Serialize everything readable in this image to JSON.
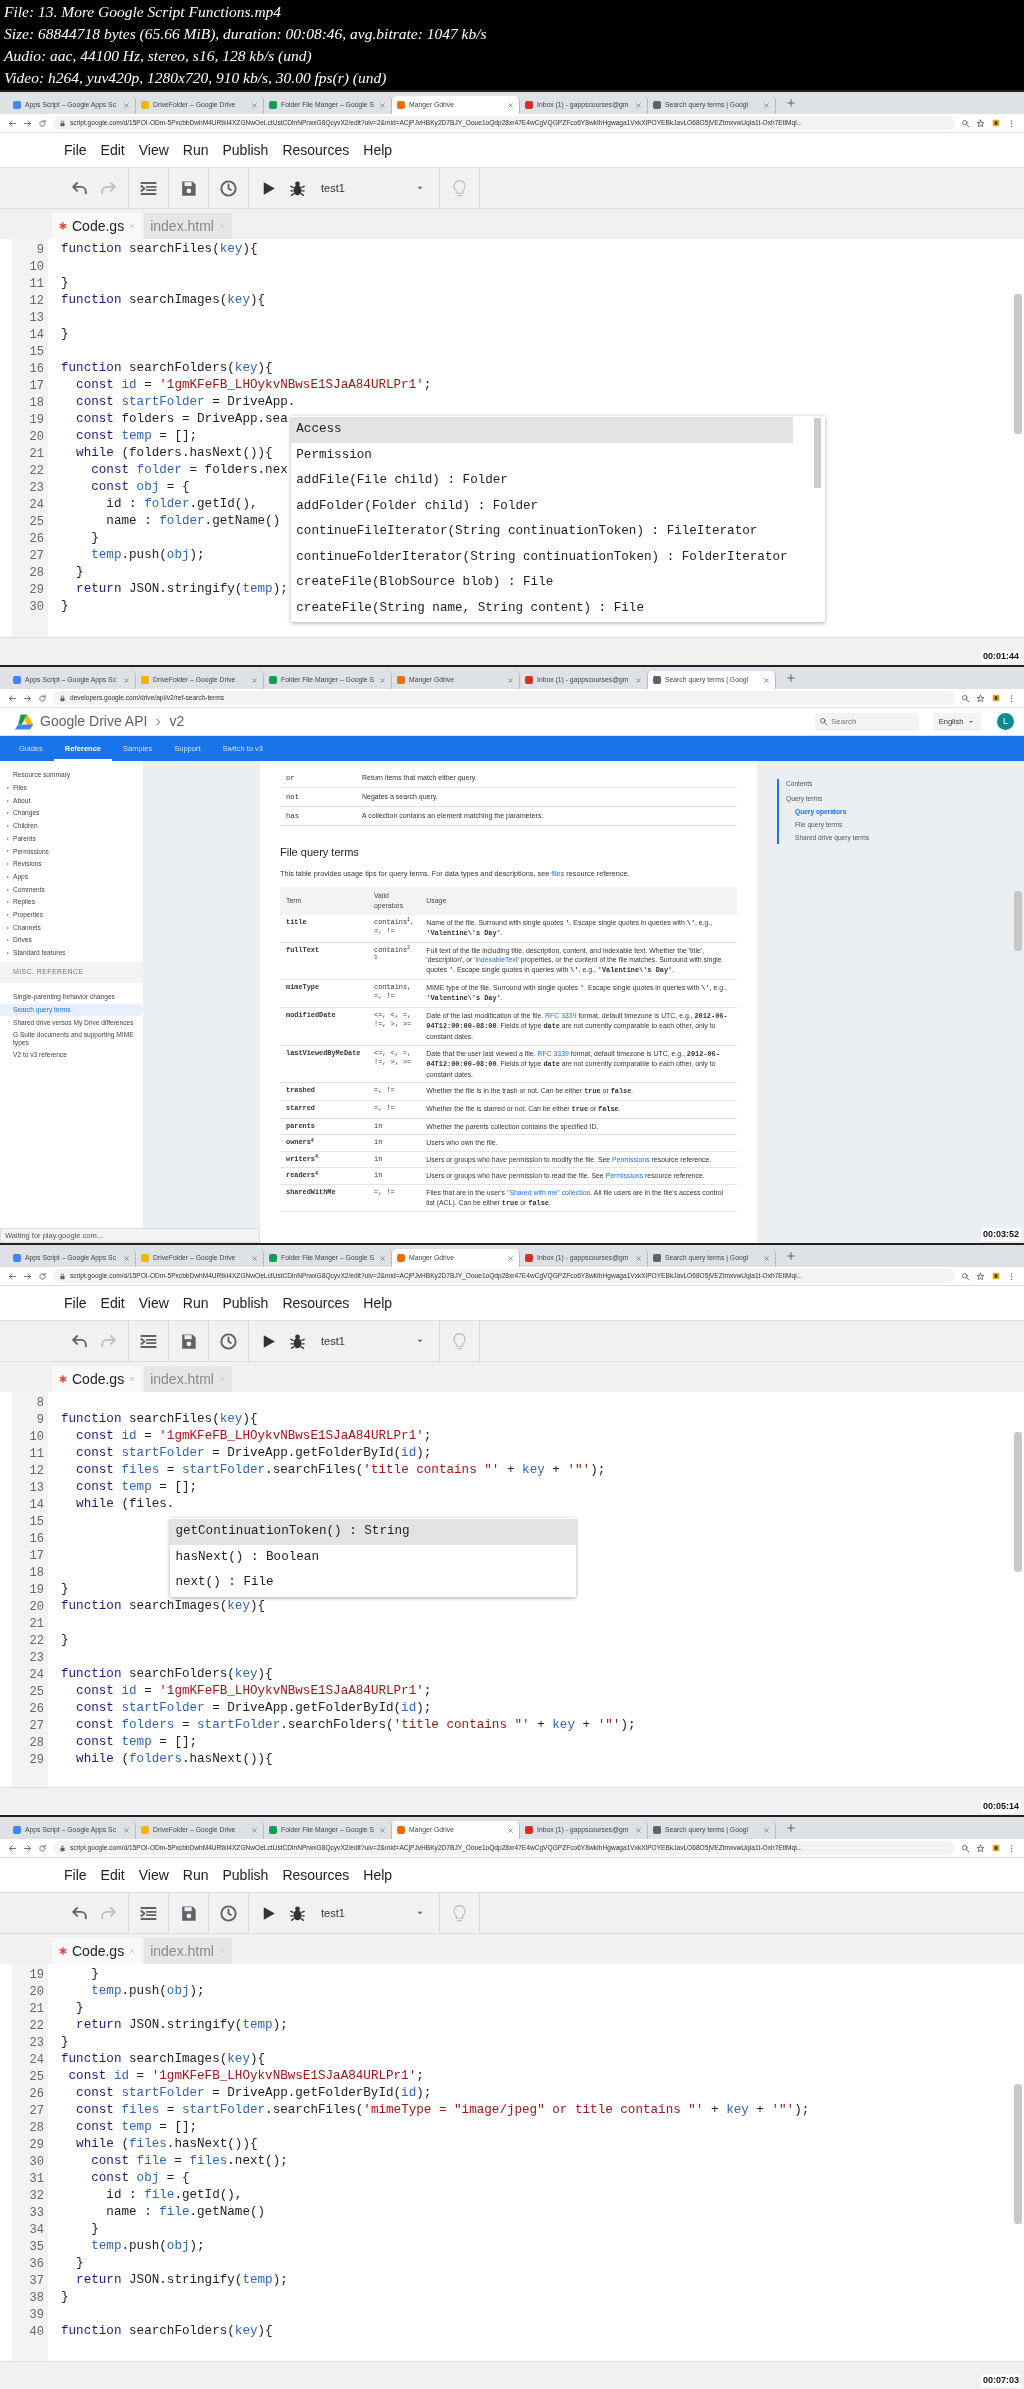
{
  "file_info": [
    "File: 13. More Google Script Functions.mp4",
    "Size: 68844718 bytes (65.66 MiB), duration: 00:08:46, avg.bitrate: 1047 kb/s",
    "Audio: aac, 44100 Hz, stereo, s16, 128 kb/s (und)",
    "Video: h264, yuv420p, 1280x720, 910 kb/s, 30.00 fps(r) (und)"
  ],
  "frames": [
    {
      "kind": "editor",
      "timestamp": "00:01:44",
      "browser": {
        "tabs": [
          {
            "title": "Apps Script – Google Apps Sc",
            "selected": false,
            "color": "#4285f4"
          },
          {
            "title": "DriveFolder – Google Drive",
            "selected": false,
            "color": "#f4b400"
          },
          {
            "title": "Folder File Manger – Google S",
            "selected": false,
            "color": "#0f9d58"
          },
          {
            "title": "Manger Gdrive",
            "selected": true,
            "color": "#e8710a"
          },
          {
            "title": "Inbox (1) - gappscourses@gm",
            "selected": false,
            "color": "#d93025"
          },
          {
            "title": "Search query terms | Googl",
            "selected": false,
            "color": "#5f6368"
          }
        ],
        "url": "script.google.com/d/15POI-ODm-5PxcbbDwhM4URtkI4XZGNwOeLctUstCDlnNPrwxG8QcyvX2/edit?uiv=2&mid=ACjPJvHBKy2D7BJY_Ooue1oQdp28xr47E4wCgVQGPZFco6Y8wkIhHgwaga1VxkXlPOYEBkJavLO68O5jVEZtmxvwUqla1t-Oxh7EtlMql..."
      },
      "menu": [
        "File",
        "Edit",
        "View",
        "Run",
        "Publish",
        "Resources",
        "Help"
      ],
      "toolbar": {
        "redo_disabled": true,
        "function": "test1"
      },
      "file_tabs": [
        {
          "label": "Code.gs",
          "selected": true,
          "modified": true
        },
        {
          "label": "index.html",
          "selected": false,
          "modified": false
        }
      ],
      "code": [
        {
          "n": "9",
          "tokens": [
            {
              "text": "function ",
              "kind": "kw"
            },
            {
              "text": "searchFiles("
            },
            {
              "text": "key",
              "kind": "var"
            },
            {
              "text": "){"
            }
          ]
        },
        {
          "n": "10"
        },
        {
          "n": "11",
          "tokens": [
            {
              "text": "}"
            }
          ]
        },
        {
          "n": "12",
          "tokens": [
            {
              "text": "function ",
              "kind": "kw"
            },
            {
              "text": "searchImages("
            },
            {
              "text": "key",
              "kind": "var"
            },
            {
              "text": "){"
            }
          ]
        },
        {
          "n": "13"
        },
        {
          "n": "14",
          "tokens": [
            {
              "text": "}"
            }
          ]
        },
        {
          "n": "15"
        },
        {
          "n": "16",
          "tokens": [
            {
              "text": "function ",
              "kind": "kw"
            },
            {
              "text": "searchFolders("
            },
            {
              "text": "key",
              "kind": "var"
            },
            {
              "text": "){"
            }
          ]
        },
        {
          "n": "17",
          "tokens": [
            {
              "text": "  const ",
              "kind": "kw"
            },
            {
              "text": "id",
              "kind": "var"
            },
            {
              "text": " = "
            },
            {
              "text": "'1gmKFeFB_LHOykvNBwsE1SJaA84URLPr1'",
              "kind": "str"
            },
            {
              "text": ";"
            }
          ]
        },
        {
          "n": "18",
          "tokens": [
            {
              "text": "  const ",
              "kind": "kw"
            },
            {
              "text": "startFolder",
              "kind": "var"
            },
            {
              "text": " = DriveApp."
            }
          ],
          "autocomplete": [
            {
              "label": "Access",
              "selected": true
            },
            {
              "label": "Permission",
              "selected": false
            },
            {
              "label": "addFile(File child) : Folder",
              "selected": false
            },
            {
              "label": "addFolder(Folder child) : Folder",
              "selected": false
            },
            {
              "label": "continueFileIterator(String continuationToken) : FileIterator",
              "selected": false
            },
            {
              "label": "continueFolderIterator(String continuationToken) : FolderIterator",
              "selected": false
            },
            {
              "label": "createFile(BlobSource blob) : File",
              "selected": false
            },
            {
              "label": "createFile(String name, String content) : File",
              "selected": false
            }
          ]
        },
        {
          "n": "19",
          "tokens": [
            {
              "text": "  const ",
              "kind": "kw"
            },
            {
              "text": "folders = DriveApp.sea"
            }
          ]
        },
        {
          "n": "20",
          "tokens": [
            {
              "text": "  const ",
              "kind": "kw"
            },
            {
              "text": "temp",
              "kind": "var"
            },
            {
              "text": " = [];"
            }
          ]
        },
        {
          "n": "21",
          "tokens": [
            {
              "text": "  while ",
              "kind": "kw"
            },
            {
              "text": "(folders.hasNext()){"
            }
          ]
        },
        {
          "n": "22",
          "tokens": [
            {
              "text": "    const ",
              "kind": "kw"
            },
            {
              "text": "folder",
              "kind": "var"
            },
            {
              "text": " = folders.nex"
            }
          ]
        },
        {
          "n": "23",
          "tokens": [
            {
              "text": "    const ",
              "kind": "kw"
            },
            {
              "text": "obj",
              "kind": "var"
            },
            {
              "text": " = {"
            }
          ]
        },
        {
          "n": "24",
          "tokens": [
            {
              "text": "      id : "
            },
            {
              "text": "folder",
              "kind": "var"
            },
            {
              "text": ".getId(),"
            }
          ]
        },
        {
          "n": "25",
          "tokens": [
            {
              "text": "      name : "
            },
            {
              "text": "folder",
              "kind": "var"
            },
            {
              "text": ".getName()"
            }
          ]
        },
        {
          "n": "26",
          "tokens": [
            {
              "text": "    }"
            }
          ]
        },
        {
          "n": "27",
          "tokens": [
            {
              "text": "    temp",
              "kind": "var"
            },
            {
              "text": ".push("
            },
            {
              "text": "obj",
              "kind": "var"
            },
            {
              "text": ");"
            }
          ]
        },
        {
          "n": "28",
          "tokens": [
            {
              "text": "  }"
            }
          ]
        },
        {
          "n": "29",
          "tokens": [
            {
              "text": "  return ",
              "kind": "kw"
            },
            {
              "text": "JSON.stringify("
            },
            {
              "text": "temp",
              "kind": "var"
            },
            {
              "text": ");"
            }
          ]
        },
        {
          "n": "30",
          "tokens": [
            {
              "text": "}"
            }
          ]
        }
      ]
    },
    {
      "kind": "docs",
      "timestamp": "00:03:52",
      "browser": {
        "tabs": [
          {
            "title": "Apps Script – Google Apps Sc",
            "selected": false,
            "color": "#4285f4"
          },
          {
            "title": "DriveFolder – Google Drive",
            "selected": false,
            "color": "#f4b400"
          },
          {
            "title": "Folder File Manger – Google S",
            "selected": false,
            "color": "#0f9d58"
          },
          {
            "title": "Manger Gdrive",
            "selected": false,
            "color": "#e8710a"
          },
          {
            "title": "Inbox (1) - gappscourses@gm",
            "selected": false,
            "color": "#d93025"
          },
          {
            "title": "Search query terms | Googl",
            "selected": true,
            "color": "#5f6368"
          }
        ],
        "url": "developers.google.com/drive/api/v2/ref-search-terms"
      },
      "page": {
        "breadcrumb": [
          "Google Drive API",
          "v2"
        ],
        "search_placeholder": "Search",
        "language": "English",
        "avatar": "L",
        "nav": [
          {
            "label": "Guides",
            "selected": false
          },
          {
            "label": "Reference",
            "selected": true
          },
          {
            "label": "Samples",
            "selected": false
          },
          {
            "label": "Support",
            "selected": false
          },
          {
            "label": "Switch to v3",
            "selected": false
          }
        ],
        "sidebar": {
          "items": [
            {
              "label": "Resource summary",
              "expandable": false
            },
            {
              "label": "Files",
              "expandable": true
            },
            {
              "label": "About",
              "expandable": true
            },
            {
              "label": "Changes",
              "expandable": true
            },
            {
              "label": "Children",
              "expandable": true
            },
            {
              "label": "Parents",
              "expandable": true
            },
            {
              "label": "Permissions",
              "expandable": true
            },
            {
              "label": "Revisions",
              "expandable": true
            },
            {
              "label": "Apps",
              "expandable": true
            },
            {
              "label": "Comments",
              "expandable": true
            },
            {
              "label": "Replies",
              "expandable": true
            },
            {
              "label": "Properties",
              "expandable": true
            },
            {
              "label": "Channels",
              "expandable": true
            },
            {
              "label": "Drives",
              "expandable": true
            },
            {
              "label": "Standard features",
              "expandable": true
            }
          ],
          "section": "MISC. REFERENCE",
          "section_items": [
            {
              "label": "Single-parenting behavior changes",
              "selected": false
            },
            {
              "label": "Search query terms",
              "selected": true
            },
            {
              "label": "Shared drive versus My Drive differences",
              "selected": false
            },
            {
              "label": "G Suite documents and supporting MIME types",
              "selected": false
            },
            {
              "label": "V2 to v3 reference",
              "selected": false
            }
          ]
        },
        "operators": [
          {
            "op": "or",
            "desc": "Return items that match either query."
          },
          {
            "op": "not",
            "desc": "Negates a search query."
          },
          {
            "op": "has",
            "desc": "A collection contains an element matching the parameters."
          }
        ],
        "heading": "File query terms",
        "intro": [
          {
            "text": "This table provides usage tips for query terms. For data types and descriptions, see "
          },
          {
            "text": "files",
            "kind": "link"
          },
          {
            "text": " resource reference."
          }
        ],
        "table": {
          "columns": [
            "Term",
            "Valid operators",
            "Usage"
          ],
          "rows": [
            {
              "term": "title",
              "operators": "contains$^{1}$, =, !=",
              "usage": [
                {
                  "text": "Name of the file. Surround with single quotes "
                },
                {
                  "text": "'",
                  "kind": "code"
                },
                {
                  "text": ". Escape single quotes in queries with "
                },
                {
                  "text": "\\'",
                  "kind": "code"
                },
                {
                  "text": ", e.g., "
                },
                {
                  "text": "'Valentine\\'s Day'",
                  "kind": "code"
                },
                {
                  "text": "."
                }
              ]
            },
            {
              "term": "fullText",
              "operators": "contains$^{2}$ $^{3}$",
              "usage": [
                {
                  "text": "Full text of the file including title, description, content, and indexable text. Whether the 'title', 'description', or "
                },
                {
                  "text": "'indexableText'",
                  "kind": "link"
                },
                {
                  "text": " properties, or the content of the file matches. Surround with single quotes "
                },
                {
                  "text": "'",
                  "kind": "code"
                },
                {
                  "text": ". Escape single quotes in queries with "
                },
                {
                  "text": "\\'",
                  "kind": "code"
                },
                {
                  "text": ", e.g., "
                },
                {
                  "text": "'Valentine\\'s Day'",
                  "kind": "code"
                },
                {
                  "text": "."
                }
              ]
            },
            {
              "term": "mimeType",
              "operators": "contains, =, !=",
              "usage": [
                {
                  "text": "MIME type of the file. Surround with single quotes "
                },
                {
                  "text": "'",
                  "kind": "code"
                },
                {
                  "text": ". Escape single quotes in queries with "
                },
                {
                  "text": "\\'",
                  "kind": "code"
                },
                {
                  "text": ", e.g., "
                },
                {
                  "text": "'Valentine\\'s Day'",
                  "kind": "code"
                },
                {
                  "text": "."
                }
              ]
            },
            {
              "term": "modifiedDate",
              "operators": "<=, <, =, !=, >, >=",
              "usage": [
                {
                  "text": "Date of the last modification of the file. "
                },
                {
                  "text": "RFC 3339",
                  "kind": "link"
                },
                {
                  "text": " format, default timezone is UTC, e.g., "
                },
                {
                  "text": "2012-06-04T12:00:00-08:00",
                  "kind": "code"
                },
                {
                  "text": ". Fields of type "
                },
                {
                  "text": "date",
                  "kind": "code"
                },
                {
                  "text": " are not currently comparable to each other, only to constant dates."
                }
              ]
            },
            {
              "term": "lastViewedByMeDate",
              "operators": "<=, <, =, !=, >, >=",
              "usage": [
                {
                  "text": "Date that the user last viewed a file. "
                },
                {
                  "text": "RFC 3339",
                  "kind": "link"
                },
                {
                  "text": " format, default timezone is UTC, e.g., "
                },
                {
                  "text": "2012-06-04T12:00:00-08:00",
                  "kind": "code"
                },
                {
                  "text": ". Fields of type "
                },
                {
                  "text": "date",
                  "kind": "code"
                },
                {
                  "text": " are not currently comparable to each other, only to constant dates."
                }
              ]
            },
            {
              "term": "trashed",
              "operators": "=, !=",
              "usage": [
                {
                  "text": "Whether the file is in the trash or not. Can be either "
                },
                {
                  "text": "true",
                  "kind": "code"
                },
                {
                  "text": " or "
                },
                {
                  "text": "false",
                  "kind": "code"
                },
                {
                  "text": "."
                }
              ]
            },
            {
              "term": "starred",
              "operators": "=, !=",
              "usage": [
                {
                  "text": "Whether the file is starred or not. Can be either "
                },
                {
                  "text": "true",
                  "kind": "code"
                },
                {
                  "text": " or "
                },
                {
                  "text": "false",
                  "kind": "code"
                },
                {
                  "text": "."
                }
              ]
            },
            {
              "term": "parents",
              "operators": "in",
              "usage": [
                {
                  "text": "Whether the parents collection contains the specified ID."
                }
              ]
            },
            {
              "term": "owners$^{4}$",
              "operators": "in",
              "usage": [
                {
                  "text": "Users who own the file."
                }
              ]
            },
            {
              "term": "writers$^{4}$",
              "operators": "in",
              "usage": [
                {
                  "text": "Users or groups who have permission to modify the file. See "
                },
                {
                  "text": "Permissions",
                  "kind": "link"
                },
                {
                  "text": " resource reference."
                }
              ]
            },
            {
              "term": "readers$^{4}$",
              "operators": "in",
              "usage": [
                {
                  "text": "Users or groups who have permission to read the file. See "
                },
                {
                  "text": "Permissions",
                  "kind": "link"
                },
                {
                  "text": " resource reference."
                }
              ]
            },
            {
              "term": "sharedWithMe",
              "operators": "=, !=",
              "usage": [
                {
                  "text": "Files that are in the user's "
                },
                {
                  "text": "\"Shared with me\" collection",
                  "kind": "link"
                },
                {
                  "text": ". All file users are in the file's access control list (ACL). Can be either "
                },
                {
                  "text": "true",
                  "kind": "code"
                },
                {
                  "text": " or "
                },
                {
                  "text": "false",
                  "kind": "code"
                },
                {
                  "text": "."
                }
              ]
            }
          ]
        },
        "toc": {
          "title": "Contents",
          "items": [
            {
              "label": "Query terms",
              "selected": false,
              "children": [
                {
                  "label": "Query operators",
                  "selected": true
                },
                {
                  "label": "File query terms",
                  "selected": false
                },
                {
                  "label": "Shared drive query terms",
                  "selected": false
                }
              ]
            }
          ]
        },
        "status": "Waiting for play.google.com..."
      }
    },
    {
      "kind": "editor",
      "timestamp": "00:05:14",
      "browser": {
        "tabs": [
          {
            "title": "Apps Script – Google Apps Sc",
            "selected": false,
            "color": "#4285f4"
          },
          {
            "title": "DriveFolder – Google Drive",
            "selected": false,
            "color": "#f4b400"
          },
          {
            "title": "Folder File Manger – Google S",
            "selected": false,
            "color": "#0f9d58"
          },
          {
            "title": "Manger Gdrive",
            "selected": true,
            "color": "#e8710a"
          },
          {
            "title": "Inbox (1) - gappscourses@gm",
            "selected": false,
            "color": "#d93025"
          },
          {
            "title": "Search query terms | Googl",
            "selected": false,
            "color": "#5f6368"
          }
        ],
        "url": "script.google.com/d/15POI-ODm-5PxcbbDwhM4URtkI4XZGNwOeLctUstCDlnNPrwxG8QcyvX2/edit?uiv=2&mid=ACjPJvHBKy2D7BJY_Ooue1oQdp28xr47E4wCgVQGPZFco6Y8wkIhHgwaga1VxkXlPOYEBkJavLO68O5jVEZtmxvwUqla1t-Oxh7EtlMql..."
      },
      "menu": [
        "File",
        "Edit",
        "View",
        "Run",
        "Publish",
        "Resources",
        "Help"
      ],
      "toolbar": {
        "redo_disabled": true,
        "function": "test1"
      },
      "file_tabs": [
        {
          "label": "Code.gs",
          "selected": true,
          "modified": true
        },
        {
          "label": "index.html",
          "selected": false,
          "modified": false
        }
      ],
      "code": [
        {
          "n": "8"
        },
        {
          "n": "9",
          "tokens": [
            {
              "text": "function ",
              "kind": "kw"
            },
            {
              "text": "searchFiles("
            },
            {
              "text": "key",
              "kind": "var"
            },
            {
              "text": "){"
            }
          ]
        },
        {
          "n": "10",
          "tokens": [
            {
              "text": "  const ",
              "kind": "kw"
            },
            {
              "text": "id",
              "kind": "var"
            },
            {
              "text": " = "
            },
            {
              "text": "'1gmKFeFB_LHOykvNBwsE1SJaA84URLPr1'",
              "kind": "str"
            },
            {
              "text": ";"
            }
          ]
        },
        {
          "n": "11",
          "tokens": [
            {
              "text": "  const ",
              "kind": "kw"
            },
            {
              "text": "startFolder",
              "kind": "var"
            },
            {
              "text": " = DriveApp.getFolderById("
            },
            {
              "text": "id",
              "kind": "var"
            },
            {
              "text": ");"
            }
          ]
        },
        {
          "n": "12",
          "tokens": [
            {
              "text": "  const ",
              "kind": "kw"
            },
            {
              "text": "files",
              "kind": "var"
            },
            {
              "text": " = "
            },
            {
              "text": "startFolder",
              "kind": "var"
            },
            {
              "text": ".searchFiles("
            },
            {
              "text": "'title contains \"'",
              "kind": "str"
            },
            {
              "text": " + "
            },
            {
              "text": "key",
              "kind": "var"
            },
            {
              "text": " + "
            },
            {
              "text": "'\"'",
              "kind": "str"
            },
            {
              "text": ");"
            }
          ]
        },
        {
          "n": "13",
          "tokens": [
            {
              "text": "  const ",
              "kind": "kw"
            },
            {
              "text": "temp",
              "kind": "var"
            },
            {
              "text": " = [];"
            }
          ]
        },
        {
          "n": "14",
          "tokens": [
            {
              "text": "  while ",
              "kind": "kw"
            },
            {
              "text": "(files."
            }
          ],
          "autocomplete": [
            {
              "label": "getContinuationToken() : String",
              "selected": true
            },
            {
              "label": "hasNext() : Boolean",
              "selected": false
            },
            {
              "label": "next() : File",
              "selected": false
            }
          ]
        },
        {
          "n": "15"
        },
        {
          "n": "16"
        },
        {
          "n": "17"
        },
        {
          "n": "18"
        },
        {
          "n": "19",
          "tokens": [
            {
              "text": "}"
            }
          ]
        },
        {
          "n": "20",
          "tokens": [
            {
              "text": "function ",
              "kind": "kw"
            },
            {
              "text": "searchImages("
            },
            {
              "text": "key",
              "kind": "var"
            },
            {
              "text": "){"
            }
          ]
        },
        {
          "n": "21"
        },
        {
          "n": "22",
          "tokens": [
            {
              "text": "}"
            }
          ]
        },
        {
          "n": "23"
        },
        {
          "n": "24",
          "tokens": [
            {
              "text": "function ",
              "kind": "kw"
            },
            {
              "text": "searchFolders("
            },
            {
              "text": "key",
              "kind": "var"
            },
            {
              "text": "){"
            }
          ]
        },
        {
          "n": "25",
          "tokens": [
            {
              "text": "  const ",
              "kind": "kw"
            },
            {
              "text": "id",
              "kind": "var"
            },
            {
              "text": " = "
            },
            {
              "text": "'1gmKFeFB_LHOykvNBwsE1SJaA84URLPr1'",
              "kind": "str"
            },
            {
              "text": ";"
            }
          ]
        },
        {
          "n": "26",
          "tokens": [
            {
              "text": "  const ",
              "kind": "kw"
            },
            {
              "text": "startFolder",
              "kind": "var"
            },
            {
              "text": " = DriveApp.getFolderById("
            },
            {
              "text": "id",
              "kind": "var"
            },
            {
              "text": ");"
            }
          ]
        },
        {
          "n": "27",
          "tokens": [
            {
              "text": "  const ",
              "kind": "kw"
            },
            {
              "text": "folders",
              "kind": "var"
            },
            {
              "text": " = "
            },
            {
              "text": "startFolder",
              "kind": "var"
            },
            {
              "text": ".searchFolders("
            },
            {
              "text": "'title contains \"'",
              "kind": "str"
            },
            {
              "text": " + "
            },
            {
              "text": "key",
              "kind": "var"
            },
            {
              "text": " + "
            },
            {
              "text": "'\"'",
              "kind": "str"
            },
            {
              "text": ");"
            }
          ]
        },
        {
          "n": "28",
          "tokens": [
            {
              "text": "  const ",
              "kind": "kw"
            },
            {
              "text": "temp",
              "kind": "var"
            },
            {
              "text": " = [];"
            }
          ]
        },
        {
          "n": "29",
          "tokens": [
            {
              "text": "  while ",
              "kind": "kw"
            },
            {
              "text": "("
            },
            {
              "text": "folders",
              "kind": "var"
            },
            {
              "text": ".hasNext()){"
            }
          ]
        }
      ]
    },
    {
      "kind": "editor",
      "timestamp": "00:07:03",
      "browser": {
        "tabs": [
          {
            "title": "Apps Script – Google Apps Sc",
            "selected": false,
            "color": "#4285f4"
          },
          {
            "title": "DriveFolder – Google Drive",
            "selected": false,
            "color": "#f4b400"
          },
          {
            "title": "Folder File Manger – Google S",
            "selected": false,
            "color": "#0f9d58"
          },
          {
            "title": "Manger Gdrive",
            "selected": true,
            "color": "#e8710a"
          },
          {
            "title": "Inbox (1) - gappscourses@gm",
            "selected": false,
            "color": "#d93025"
          },
          {
            "title": "Search query terms | Googl",
            "selected": false,
            "color": "#5f6368"
          }
        ],
        "url": "script.google.com/d/15POI-ODm-5PxcbbDwhM4URtkI4XZGNwOeLctUstCDlnNPrwxG8QcyvX2/edit?uiv=2&mid=ACjPJvHBKy2D7BJY_Ooue1oQdp28xr47E4wCgVQGPZFco6Y8wkIhHgwaga1VxkXlPOYEBkJavLO68O5jVEZtmxvwUqla1t-Oxh7EtlMql..."
      },
      "menu": [
        "File",
        "Edit",
        "View",
        "Run",
        "Publish",
        "Resources",
        "Help"
      ],
      "toolbar": {
        "redo_disabled": true,
        "function": "test1"
      },
      "file_tabs": [
        {
          "label": "Code.gs",
          "selected": true,
          "modified": true
        },
        {
          "label": "index.html",
          "selected": false,
          "modified": false
        }
      ],
      "code": [
        {
          "n": "19",
          "tokens": [
            {
              "text": "    }"
            }
          ]
        },
        {
          "n": "20",
          "tokens": [
            {
              "text": "    temp",
              "kind": "var"
            },
            {
              "text": ".push("
            },
            {
              "text": "obj",
              "kind": "var"
            },
            {
              "text": ");"
            }
          ]
        },
        {
          "n": "21",
          "tokens": [
            {
              "text": "  }"
            }
          ]
        },
        {
          "n": "22",
          "tokens": [
            {
              "text": "  return ",
              "kind": "kw"
            },
            {
              "text": "JSON.stringify("
            },
            {
              "text": "temp",
              "kind": "var"
            },
            {
              "text": ");"
            }
          ]
        },
        {
          "n": "23",
          "tokens": [
            {
              "text": "}"
            }
          ]
        },
        {
          "n": "24",
          "tokens": [
            {
              "text": "function ",
              "kind": "kw"
            },
            {
              "text": "searchImages("
            },
            {
              "text": "key",
              "kind": "var"
            },
            {
              "text": "){"
            }
          ]
        },
        {
          "n": "25",
          "tokens": [
            {
              "text": " const ",
              "kind": "kw"
            },
            {
              "text": "id",
              "kind": "var"
            },
            {
              "text": " = "
            },
            {
              "text": "'1gmKFeFB_LHOykvNBwsE1SJaA84URLPr1'",
              "kind": "str"
            },
            {
              "text": ";"
            }
          ]
        },
        {
          "n": "26",
          "tokens": [
            {
              "text": "  const ",
              "kind": "kw"
            },
            {
              "text": "startFolder",
              "kind": "var"
            },
            {
              "text": " = DriveApp.getFolderById("
            },
            {
              "text": "id",
              "kind": "var"
            },
            {
              "text": ");"
            }
          ]
        },
        {
          "n": "27",
          "tokens": [
            {
              "text": "  const ",
              "kind": "kw"
            },
            {
              "text": "files",
              "kind": "var"
            },
            {
              "text": " = "
            },
            {
              "text": "startFolder",
              "kind": "var"
            },
            {
              "text": ".searchFiles("
            },
            {
              "text": "'mimeType = \"image/jpeg\" or title contains \"'",
              "kind": "str"
            },
            {
              "text": " + "
            },
            {
              "text": "key",
              "kind": "var"
            },
            {
              "text": " + "
            },
            {
              "text": "'\"'",
              "kind": "str"
            },
            {
              "text": ");"
            }
          ]
        },
        {
          "n": "28",
          "tokens": [
            {
              "text": "  const ",
              "kind": "kw"
            },
            {
              "text": "temp",
              "kind": "var"
            },
            {
              "text": " = [];"
            }
          ]
        },
        {
          "n": "29",
          "tokens": [
            {
              "text": "  while ",
              "kind": "kw"
            },
            {
              "text": "("
            },
            {
              "text": "files",
              "kind": "var"
            },
            {
              "text": ".hasNext()){"
            }
          ]
        },
        {
          "n": "30",
          "tokens": [
            {
              "text": "    const ",
              "kind": "kw"
            },
            {
              "text": "file",
              "kind": "var"
            },
            {
              "text": " = "
            },
            {
              "text": "files",
              "kind": "var"
            },
            {
              "text": ".next();"
            }
          ]
        },
        {
          "n": "31",
          "tokens": [
            {
              "text": "    const ",
              "kind": "kw"
            },
            {
              "text": "obj",
              "kind": "var"
            },
            {
              "text": " = {"
            }
          ]
        },
        {
          "n": "32",
          "tokens": [
            {
              "text": "      id : "
            },
            {
              "text": "file",
              "kind": "var"
            },
            {
              "text": ".getId(),"
            }
          ]
        },
        {
          "n": "33",
          "tokens": [
            {
              "text": "      name : "
            },
            {
              "text": "file",
              "kind": "var"
            },
            {
              "text": ".getName()"
            }
          ]
        },
        {
          "n": "34",
          "tokens": [
            {
              "text": "    }"
            }
          ]
        },
        {
          "n": "35",
          "tokens": [
            {
              "text": "    temp",
              "kind": "var"
            },
            {
              "text": ".push("
            },
            {
              "text": "obj",
              "kind": "var"
            },
            {
              "text": ");"
            }
          ]
        },
        {
          "n": "36",
          "tokens": [
            {
              "text": "  }"
            }
          ]
        },
        {
          "n": "37",
          "tokens": [
            {
              "text": "  return ",
              "kind": "kw"
            },
            {
              "text": "JSON.stringify("
            },
            {
              "text": "temp",
              "kind": "var"
            },
            {
              "text": ");"
            }
          ]
        },
        {
          "n": "38",
          "tokens": [
            {
              "text": "}"
            }
          ]
        },
        {
          "n": "39"
        },
        {
          "n": "40",
          "tokens": [
            {
              "text": "function ",
              "kind": "kw"
            },
            {
              "text": "searchFolders("
            },
            {
              "text": "key",
              "kind": "var"
            },
            {
              "text": "){"
            }
          ]
        }
      ]
    }
  ]
}
